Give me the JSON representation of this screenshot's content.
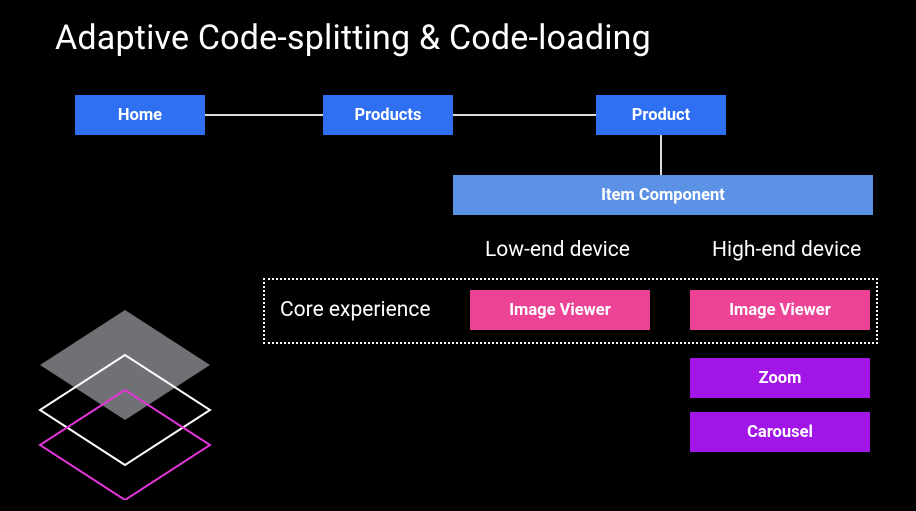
{
  "title": "Adaptive Code-splitting & Code-loading",
  "nav": {
    "home": "Home",
    "products": "Products",
    "product": "Product"
  },
  "item_component": "Item Component",
  "labels": {
    "low": "Low-end device",
    "high": "High-end device",
    "core": "Core experience"
  },
  "modules": {
    "image_viewer": "Image Viewer",
    "zoom": "Zoom",
    "carousel": "Carousel"
  },
  "colors": {
    "blue": "#2f6ff2",
    "lightblue": "#5c92e5",
    "pink": "#ec4396",
    "purple": "#a215e7"
  }
}
